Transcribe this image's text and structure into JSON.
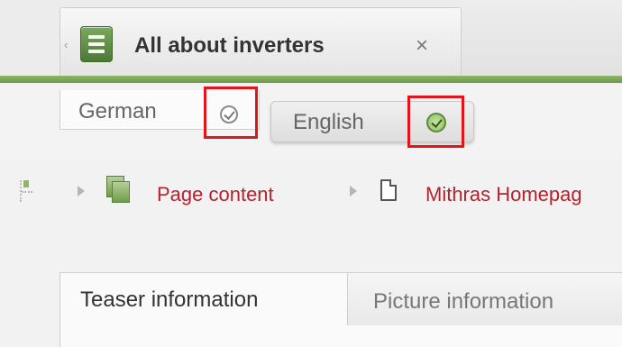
{
  "document_tab": {
    "title": "All about inverters",
    "close_glyph": "×",
    "scroll_left_glyph": "‹",
    "icon": "document-icon"
  },
  "language_tabs": [
    {
      "label": "German",
      "status_icon": "check-circle-icon",
      "active": false
    },
    {
      "label": "English",
      "status_icon": "check-circle-icon",
      "active": true
    }
  ],
  "breadcrumb": {
    "items": [
      {
        "label": "Page content",
        "icon": "pages-icon"
      },
      {
        "label": "Mithras Homepag",
        "icon": "page-icon"
      }
    ]
  },
  "content_tabs": [
    {
      "label": "Teaser information",
      "active": true
    },
    {
      "label": "Picture information",
      "active": false
    }
  ],
  "colors": {
    "accent_green": "#6a9a48",
    "highlight_red": "#e0161b",
    "link_red": "#b1232f"
  }
}
